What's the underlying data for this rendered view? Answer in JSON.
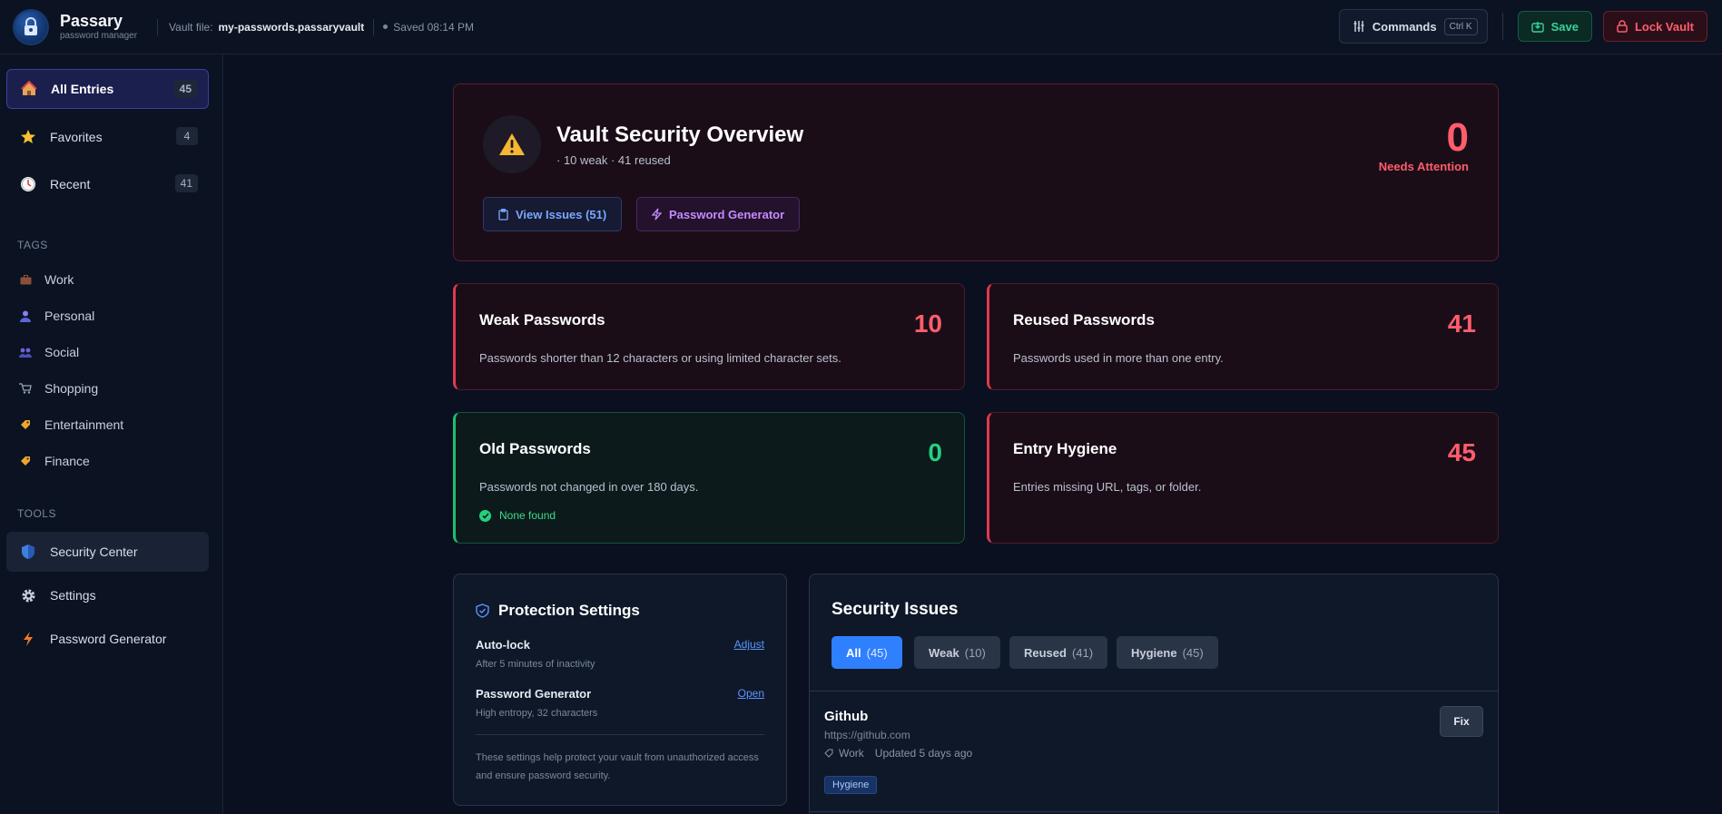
{
  "app": {
    "name": "Passary",
    "subtitle": "password manager",
    "vault_label": "Vault file:",
    "vault_file": "my-passwords.passaryvault",
    "saved_text": "Saved 08:14 PM"
  },
  "toolbar": {
    "commands_label": "Commands",
    "commands_shortcut": "Ctrl K",
    "save_label": "Save",
    "lock_label": "Lock Vault"
  },
  "sidebar": {
    "main": [
      {
        "label": "All Entries",
        "count": "45",
        "icon": "house-icon"
      },
      {
        "label": "Favorites",
        "count": "4",
        "icon": "star-icon"
      },
      {
        "label": "Recent",
        "count": "41",
        "icon": "clock-icon"
      }
    ],
    "tags_heading": "TAGS",
    "tags": [
      {
        "label": "Work",
        "icon": "briefcase-icon"
      },
      {
        "label": "Personal",
        "icon": "person-icon"
      },
      {
        "label": "Social",
        "icon": "people-icon"
      },
      {
        "label": "Shopping",
        "icon": "cart-icon"
      },
      {
        "label": "Entertainment",
        "icon": "tag-icon"
      },
      {
        "label": "Finance",
        "icon": "tag-icon"
      }
    ],
    "tools_heading": "TOOLS",
    "tools": [
      {
        "label": "Security Center",
        "icon": "shield-icon"
      },
      {
        "label": "Settings",
        "icon": "gear-icon"
      },
      {
        "label": "Password Generator",
        "icon": "lightning-icon"
      }
    ]
  },
  "overview": {
    "title": "Vault Security Overview",
    "subtitle": "· 10 weak · 41 reused",
    "attention_count": "0",
    "attention_label": "Needs Attention",
    "view_issues_label": "View Issues (51)",
    "generator_label": "Password Generator"
  },
  "stats": {
    "weak": {
      "title": "Weak Passwords",
      "value": "10",
      "desc": "Passwords shorter than 12 characters or using limited character sets."
    },
    "reused": {
      "title": "Reused Passwords",
      "value": "41",
      "desc": "Passwords used in more than one entry."
    },
    "old": {
      "title": "Old Passwords",
      "value": "0",
      "desc": "Passwords not changed in over 180 days.",
      "status": "None found"
    },
    "hygiene": {
      "title": "Entry Hygiene",
      "value": "45",
      "desc": "Entries missing URL, tags, or folder."
    }
  },
  "protection": {
    "title": "Protection Settings",
    "autolock_label": "Auto-lock",
    "autolock_value": "After 5 minutes of inactivity",
    "autolock_action": "Adjust",
    "generator_label": "Password Generator",
    "generator_value": "High entropy, 32 characters",
    "generator_action": "Open",
    "note": "These settings help protect your vault from unauthorized access and ensure password security."
  },
  "issues": {
    "title": "Security Issues",
    "filters": [
      {
        "label": "All",
        "count": "(45)"
      },
      {
        "label": "Weak",
        "count": "(10)"
      },
      {
        "label": "Reused",
        "count": "(41)"
      },
      {
        "label": "Hygiene",
        "count": "(45)"
      }
    ],
    "entries": [
      {
        "name": "Github",
        "url": "https://github.com",
        "tag": "Work",
        "updated": "Updated 5 days ago",
        "badge": "Hygiene",
        "action": "Fix"
      }
    ]
  },
  "colors": {
    "accent": "#2f80ff",
    "danger": "#ff5d6c",
    "success": "#24d17e",
    "purple": "#c48aff"
  }
}
